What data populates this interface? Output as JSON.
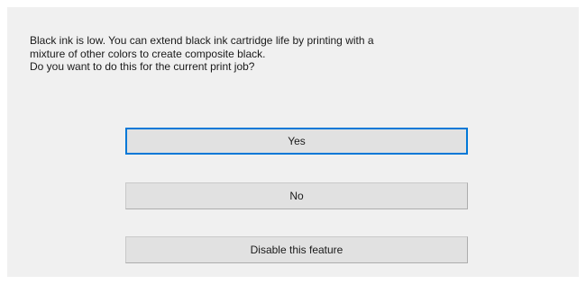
{
  "dialog": {
    "message_lines": [
      "Black ink is low. You can extend black ink cartridge life by printing with a",
      "mixture of other colors to create composite black.",
      "Do you want to do this for the current print job?"
    ],
    "buttons": {
      "yes_label": "Yes",
      "no_label": "No",
      "disable_label": "Disable this feature"
    }
  },
  "colors": {
    "dialog_background": "#f0f0f0",
    "button_background": "#e1e1e1",
    "default_button_border": "#0078d7"
  }
}
